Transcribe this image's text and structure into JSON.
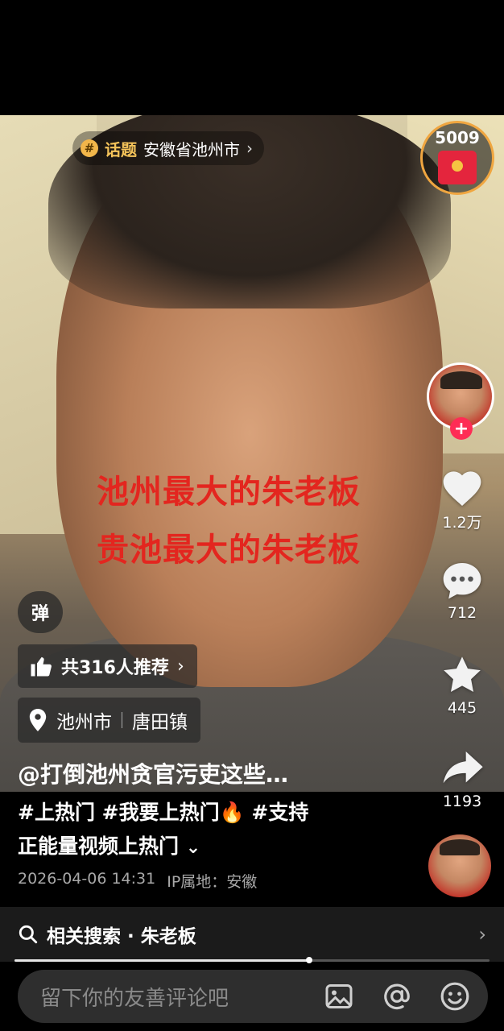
{
  "topic": {
    "tag_label": "话题",
    "text": "安徽省池州市"
  },
  "red_packet": {
    "count": "5009"
  },
  "overlay_text": [
    "池州最大的朱老板",
    "贵池最大的朱老板"
  ],
  "actions": {
    "like_count": "1.2万",
    "comment_count": "712",
    "favorite_count": "445",
    "share_count": "1193"
  },
  "danmu_label": "弹",
  "recommend": {
    "text": "共316人推荐"
  },
  "location": {
    "city": "池州市",
    "town": "唐田镇"
  },
  "author": "@打倒池州贪官污吏这些…",
  "description": {
    "line1": "#上热门 #我要上热门🔥 #支持",
    "line2": "正能量视频上热门"
  },
  "meta": {
    "datetime": "2026-04-06 14:31",
    "ip": "IP属地：安徽"
  },
  "related_search": {
    "label": "相关搜索 · 朱老板"
  },
  "progress": {
    "fraction": 0.62
  },
  "comment": {
    "placeholder": "留下你的友善评论吧"
  },
  "colors": {
    "like_red": "#fe2c55",
    "overlay_red": "#e3261f",
    "topic_gold": "#f4c35a"
  }
}
